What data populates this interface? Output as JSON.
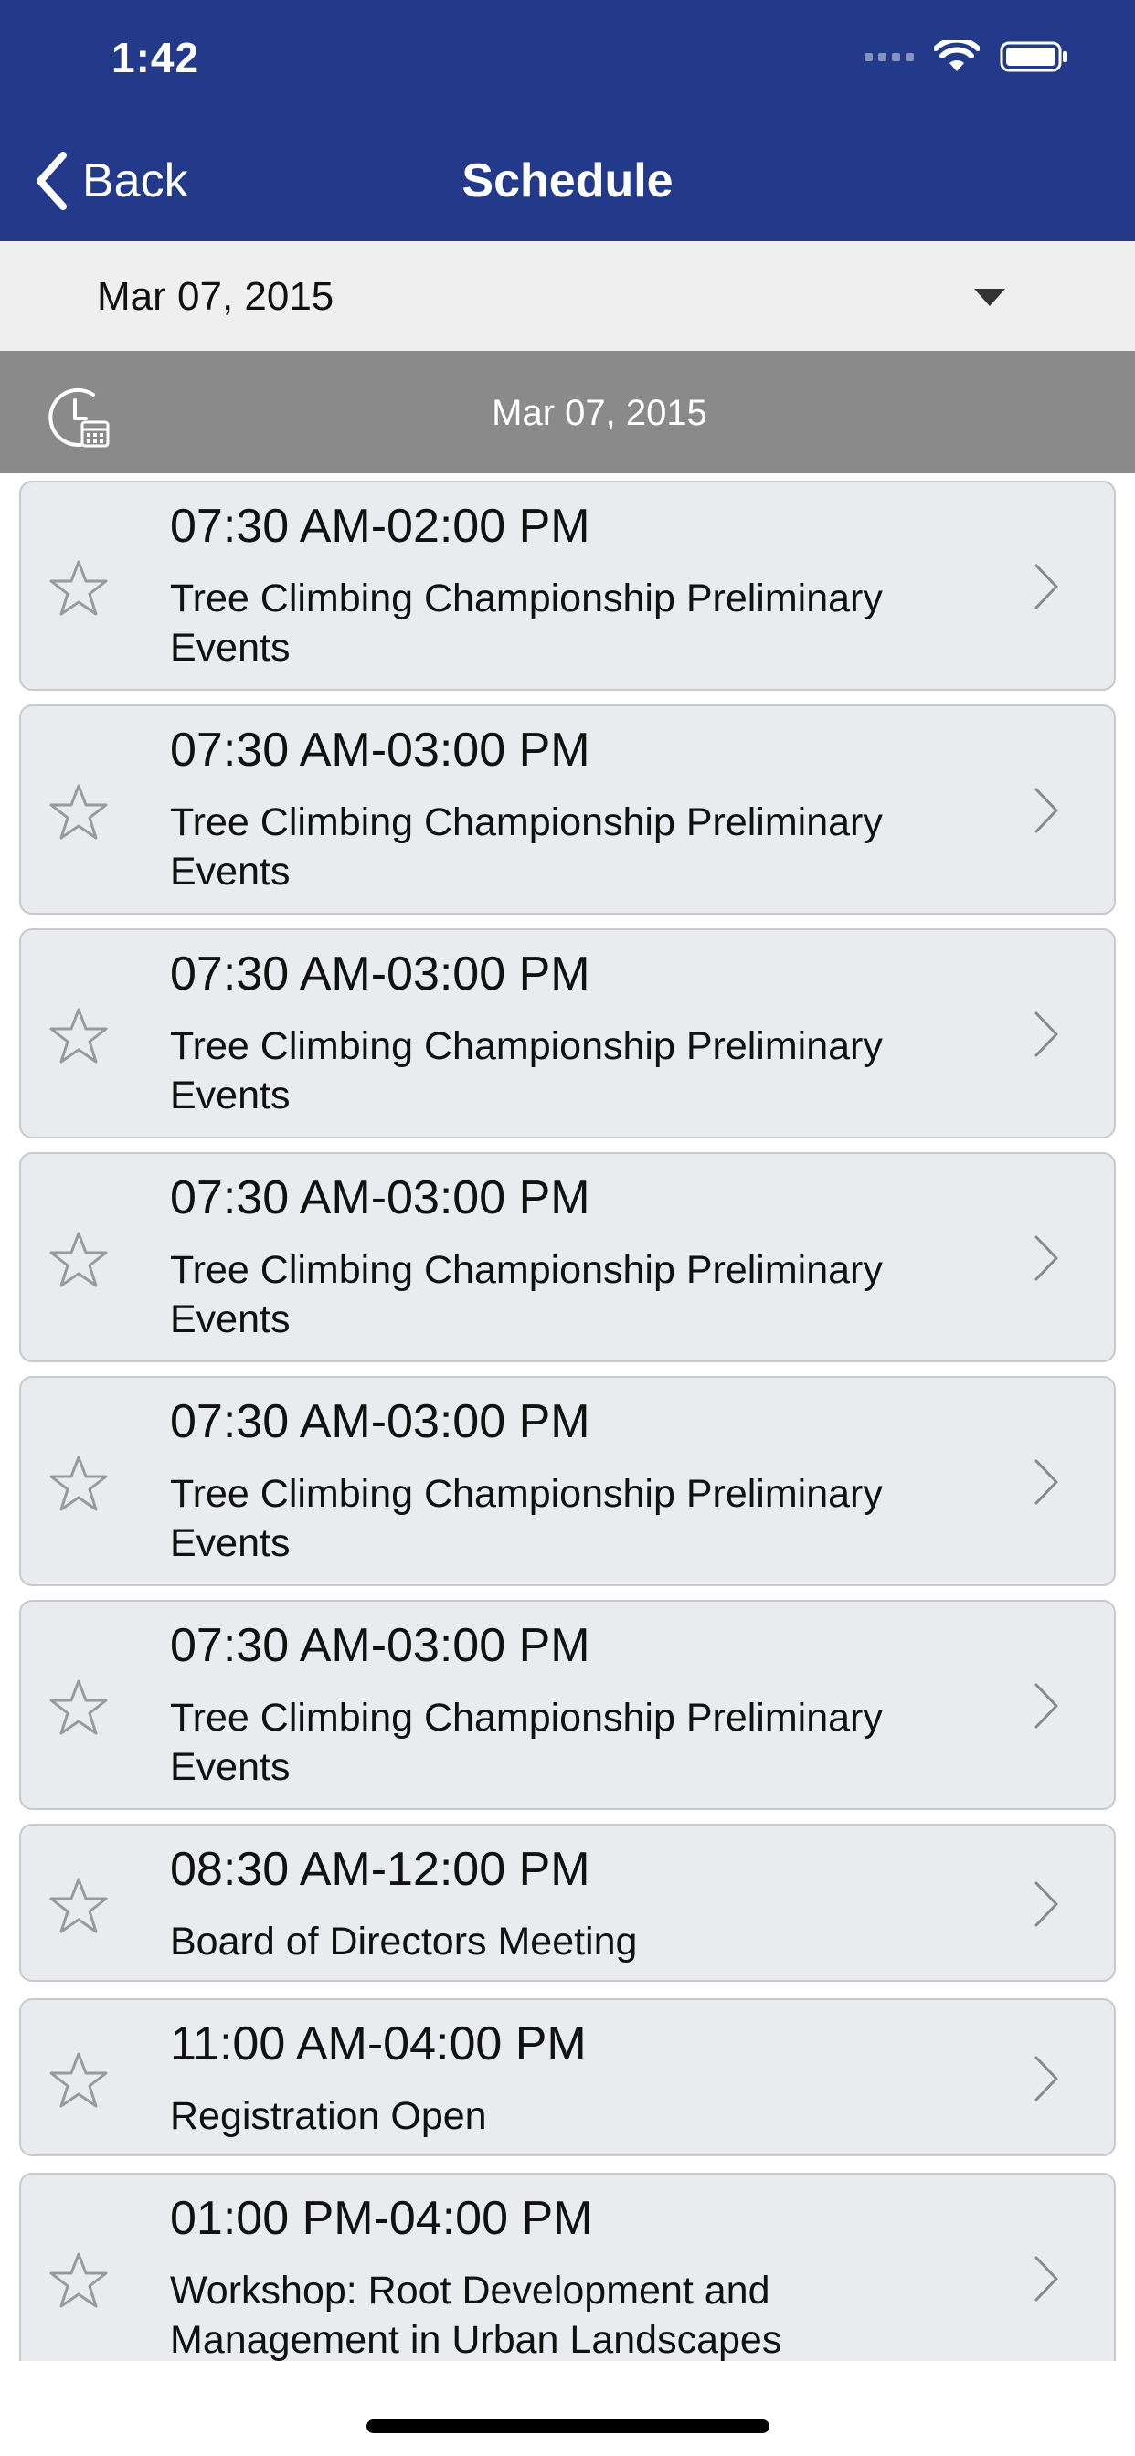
{
  "status_bar": {
    "time": "1:42"
  },
  "nav": {
    "back_label": "Back",
    "title": "Schedule"
  },
  "date_picker": {
    "value": "Mar 07, 2015"
  },
  "section": {
    "date": "Mar 07, 2015"
  },
  "events": [
    {
      "time": "07:30 AM-02:00 PM",
      "title": "Tree Climbing Championship Preliminary Events"
    },
    {
      "time": "07:30 AM-03:00 PM",
      "title": "Tree Climbing Championship Preliminary Events"
    },
    {
      "time": "07:30 AM-03:00 PM",
      "title": "Tree Climbing Championship Preliminary Events"
    },
    {
      "time": "07:30 AM-03:00 PM",
      "title": "Tree Climbing Championship Preliminary Events"
    },
    {
      "time": "07:30 AM-03:00 PM",
      "title": "Tree Climbing Championship Preliminary Events"
    },
    {
      "time": "07:30 AM-03:00 PM",
      "title": "Tree Climbing Championship Preliminary Events"
    },
    {
      "time": "08:30 AM-12:00 PM",
      "title": "Board of Directors Meeting"
    },
    {
      "time": "11:00 AM-04:00 PM",
      "title": "Registration Open"
    },
    {
      "time": "01:00 PM-04:00 PM",
      "title": "Workshop:  Root Development and Management in Urban Landscapes"
    }
  ],
  "icons": {
    "back": "chevron-left-icon",
    "dropdown": "caret-down-icon",
    "section": "clock-calendar-icon",
    "favorite": "star-outline-icon",
    "disclosure": "chevron-right-icon"
  },
  "colors": {
    "nav_background": "#233a8b",
    "picker_background": "#efefef",
    "section_background": "#8a8a8a",
    "card_background": "#e9ebee"
  }
}
